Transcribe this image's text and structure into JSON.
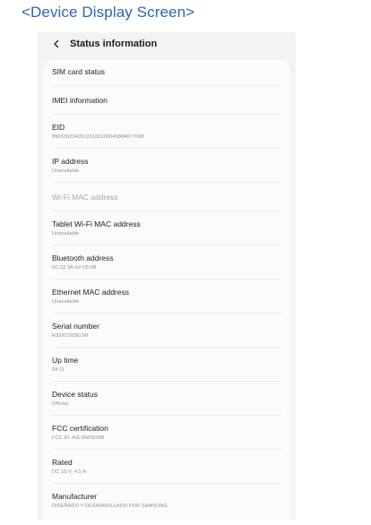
{
  "caption": "<Device Display Screen>",
  "header": {
    "title": "Status information",
    "back_icon": "chevron-left-icon"
  },
  "items": [
    {
      "label": "SIM card status",
      "value": ""
    },
    {
      "label": "IMEI information",
      "value": ""
    },
    {
      "label": "EID",
      "value": "89033023426120100100049884077068"
    },
    {
      "label": "IP address",
      "value": "Unavailable"
    },
    {
      "label": "Wi-Fi MAC address",
      "value": "",
      "disabled": true
    },
    {
      "label": "Tablet Wi-Fi MAC address",
      "value": "Unavailable"
    },
    {
      "label": "Bluetooth address",
      "value": "0C:32:3A:42:C6:08"
    },
    {
      "label": "Ethernet MAC address",
      "value": "Unavailable"
    },
    {
      "label": "Serial number",
      "value": "R32XC003GSR"
    },
    {
      "label": "Up time",
      "value": "04:11"
    },
    {
      "label": "Device status",
      "value": "Official"
    },
    {
      "label": "FCC certification",
      "value": "FCC ID: A3LSMX626B"
    },
    {
      "label": "Rated",
      "value": "DC 10 V; 4.5 A"
    },
    {
      "label": "Manufacturer",
      "value": "DISEÑADO Y DESARROLLADO POR SAMSUNG"
    }
  ],
  "colors": {
    "caption": "#2f63b5",
    "screen_bg": "#f3f3f4",
    "card_bg": "#fbfbfb",
    "disabled": "#a8a8a8"
  }
}
